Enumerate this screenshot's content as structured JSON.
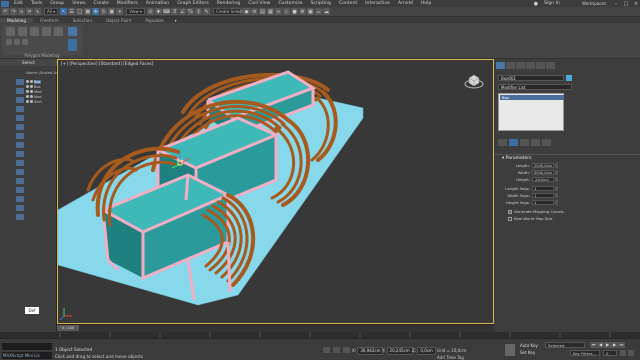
{
  "titlebar": {
    "menu": [
      "Edit",
      "Tools",
      "Group",
      "Views",
      "Create",
      "Modifiers",
      "Animation",
      "Graph Editors",
      "Rendering",
      "Civil View",
      "Customize",
      "Scripting",
      "Content",
      "Interactive",
      "Arnold",
      "Help"
    ],
    "sign_in": "Sign In",
    "workspace": "Workspaces"
  },
  "toolbar": {
    "selection_set": "Create Selection Se"
  },
  "ribbon": {
    "tabs": [
      "Modeling",
      "Freeform",
      "Selection",
      "Object Paint",
      "Populate"
    ],
    "active_tab": 0,
    "panel_label": "Polygon Modeling"
  },
  "scene_explorer": {
    "header": "Select",
    "column_name": "Name (Sorted Asc...",
    "rows": [
      {
        "name": "Box",
        "selected": true
      },
      {
        "name": "Box",
        "selected": false
      },
      {
        "name": "Mod",
        "selected": false
      },
      {
        "name": "Mod",
        "selected": false
      },
      {
        "name": "Sect",
        "selected": false
      }
    ],
    "footer_value": "Def"
  },
  "viewport": {
    "label": "[+] [Perspective] [Standard] [Edged Faces]"
  },
  "command_panel": {
    "object_name": "Box001",
    "modifier_list": "Modifier List",
    "modifier_selected": "Box",
    "params_title": "Parameters",
    "params": [
      {
        "label": "Length:",
        "value": "2000,0cm"
      },
      {
        "label": "Width:",
        "value": "5000,0cm"
      },
      {
        "label": "Height:",
        "value": "-20,0cm"
      },
      {
        "label": "Length Segs:",
        "value": "1"
      },
      {
        "label": "Width Segs:",
        "value": "1"
      },
      {
        "label": "Height Segs:",
        "value": "1"
      }
    ],
    "check_mapping": "Generate Mapping Coords.",
    "check_realworld": "Real-World Map Size"
  },
  "timeline": {
    "slider": "0 / 100"
  },
  "status": {
    "script_listener": "MAXScript Mini Lis",
    "msg1": "1 Object Selected",
    "msg2": "Click and drag to select and move objects",
    "x_label": "X:",
    "x_value": "36,942cm",
    "y_label": "Y:",
    "y_value": "20,245cm",
    "z_label": "Z:",
    "z_value": "0,0cm",
    "grid": "Grid = 10,0cm",
    "add_time_tag": "Add Time Tag",
    "auto_key": "Auto Key",
    "set_key": "Set Key",
    "selected": "Selected",
    "key_filters": "Key Filters...",
    "frame": "0"
  },
  "colors": {
    "ground": "#86d8ea",
    "box_glass": "#3fb8b8",
    "frame_pink": "#f2aec4",
    "wood": "#a65a1d",
    "accent_blue": "#3d6fa3",
    "viewport_border": "#d9b84a"
  }
}
